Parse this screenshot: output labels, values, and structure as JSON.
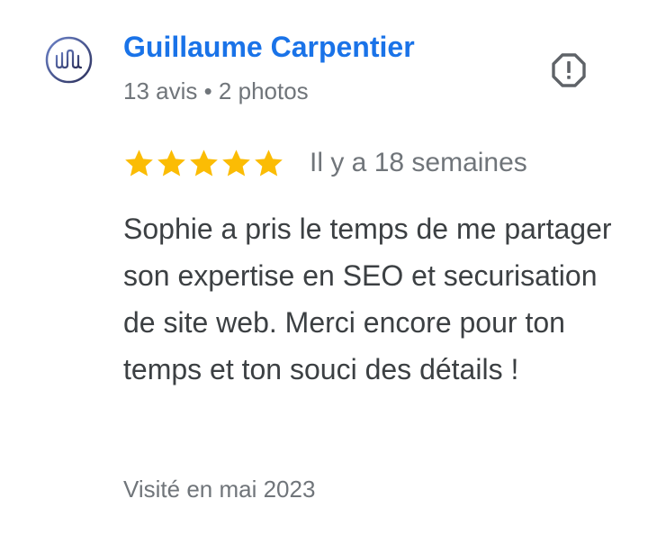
{
  "reviewer": {
    "name": "Guillaume Carpentier",
    "meta": "13 avis • 2 photos",
    "avatar_icon": "wm-logo-avatar"
  },
  "review": {
    "rating": 5,
    "rating_max": 5,
    "star_color": "#fbbc04",
    "date": "Il y a 18 semaines",
    "text": "Sophie a pris le temps de me partager son expertise en SEO et securisation de site web. Merci encore pour ton temps et ton souci des détails !",
    "visit": "Visité en mai 2023"
  },
  "actions": {
    "report_icon": "report-flag-icon"
  },
  "colors": {
    "name": "#1a73e8",
    "secondary_text": "#70757a",
    "body_text": "#3c4043",
    "icon": "#5f6368"
  }
}
